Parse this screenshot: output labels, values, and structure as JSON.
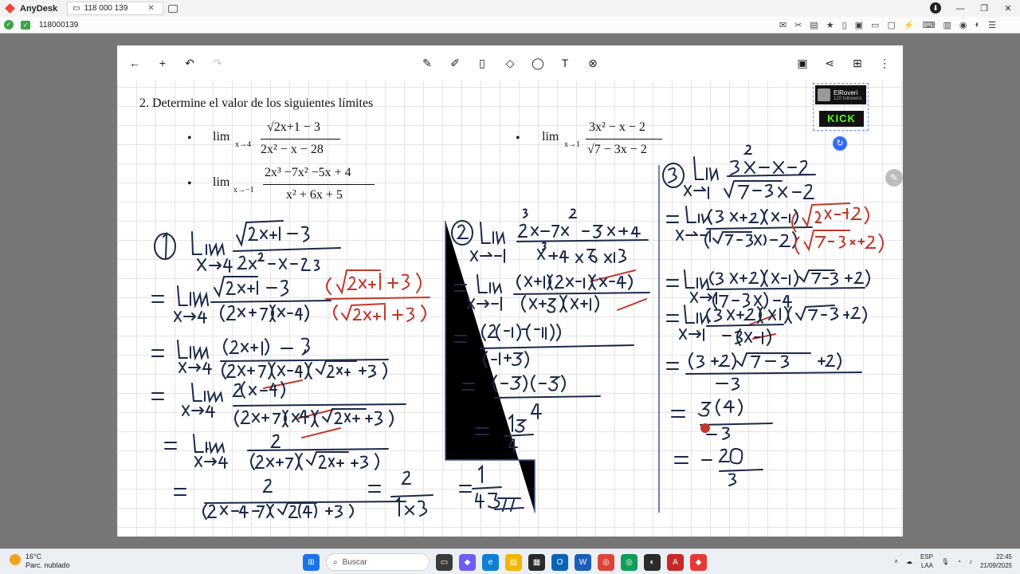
{
  "anydesk": {
    "app_name": "AnyDesk",
    "tab_label": "118 000 139",
    "address_id": "118000139"
  },
  "whiteboard": {
    "problem_heading": "2.   Determine el valor de los siguientes límites",
    "exercises": [
      {
        "lim": "lim",
        "sub": "x→4",
        "num": "√2x+1 − 3",
        "den": "2x² − x − 28"
      },
      {
        "lim": "lim",
        "sub": "x→−1",
        "num": "2x³ −7x² −5x + 4",
        "den": "x² + 6x + 5"
      },
      {
        "lim": "lim",
        "sub": "x→1",
        "num": "3x² − x − 2",
        "den": "√7 − 3x − 2"
      }
    ],
    "badge": {
      "channel": "ElRoveri",
      "followers": "120 followers",
      "brand": "KICK"
    }
  },
  "taskbar": {
    "weather_temp": "16°C",
    "weather_desc": "Parc. nublado",
    "search_placeholder": "Buscar",
    "lang_top": "ESP",
    "lang_bottom": "LAA",
    "time": "22:45",
    "date": "21/09/2025"
  }
}
